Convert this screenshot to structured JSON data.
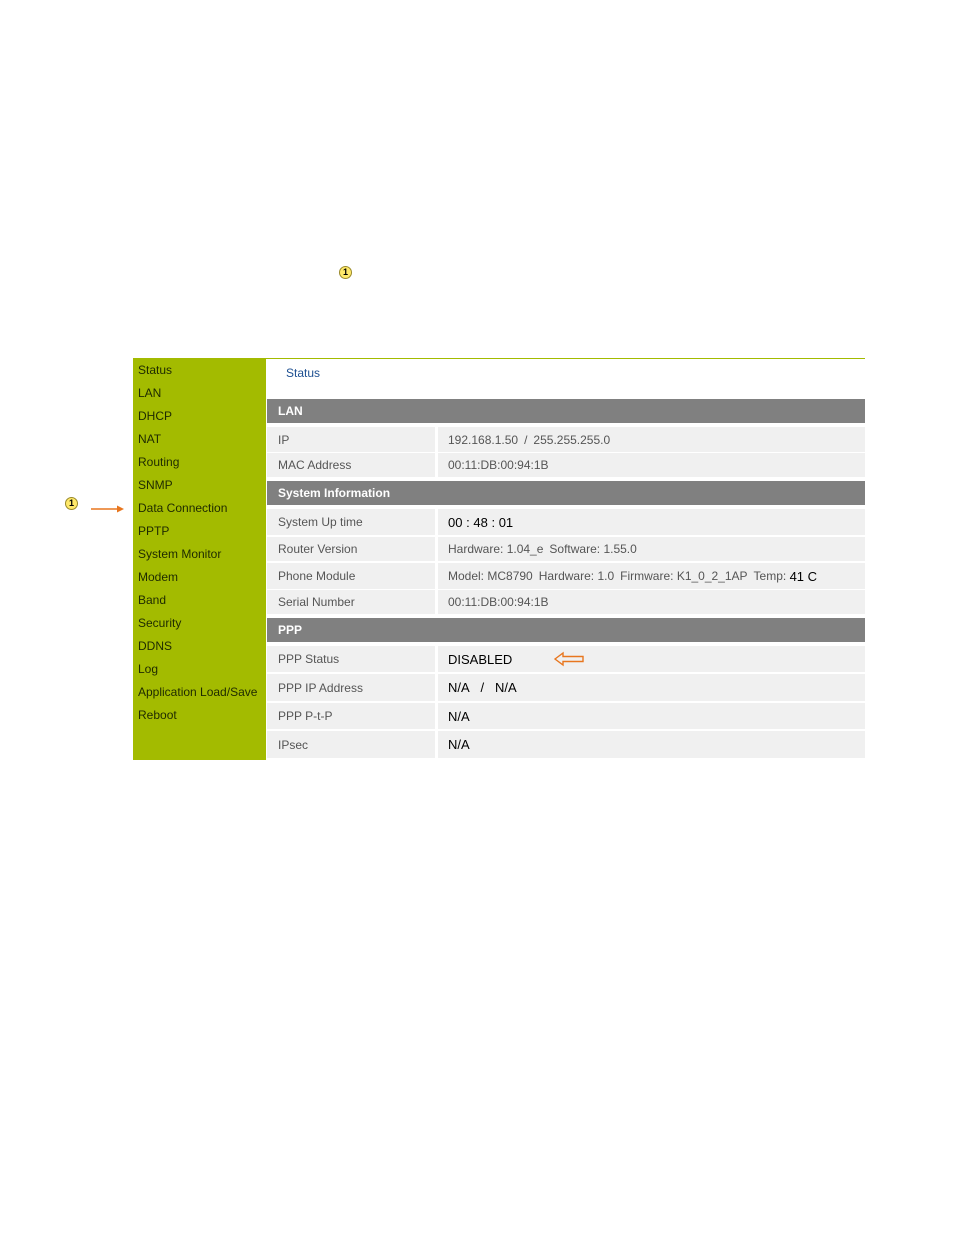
{
  "callouts": {
    "top": "1",
    "side": "1"
  },
  "sidebar": {
    "items": [
      {
        "label": "Status"
      },
      {
        "label": "LAN"
      },
      {
        "label": "DHCP"
      },
      {
        "label": "NAT"
      },
      {
        "label": "Routing"
      },
      {
        "label": "SNMP"
      },
      {
        "label": "Data Connection"
      },
      {
        "label": "PPTP"
      },
      {
        "label": "System Monitor"
      },
      {
        "label": "Modem"
      },
      {
        "label": "Band"
      },
      {
        "label": "Security"
      },
      {
        "label": "DDNS"
      },
      {
        "label": "Log"
      },
      {
        "label": "Application Load/Save"
      },
      {
        "label": "Reboot"
      }
    ]
  },
  "page": {
    "title": "Status"
  },
  "lan": {
    "header": "LAN",
    "ip": {
      "label": "IP",
      "address": "192.168.1.50",
      "sep": "/",
      "mask": "255.255.255.0"
    },
    "mac": {
      "label": "MAC Address",
      "value": "00:11:DB:00:94:1B"
    }
  },
  "system": {
    "header": "System Information",
    "uptime": {
      "label": "System Up time",
      "h": "00",
      "m": "48",
      "s": "01",
      "sep": ":"
    },
    "router": {
      "label": "Router Version",
      "hw_label": "Hardware:",
      "hw": "1.04_e",
      "sw_label": "Software:",
      "sw": "1.55.0"
    },
    "phone": {
      "label": "Phone Module",
      "model_label": "Model:",
      "model": "MC8790",
      "hw_label": "Hardware:",
      "hw": "1.0",
      "fw_label": "Firmware:",
      "fw": "K1_0_2_1AP",
      "temp_label": "Temp:",
      "temp": "41 C"
    },
    "serial": {
      "label": "Serial Number",
      "value": "00:11:DB:00:94:1B"
    }
  },
  "ppp": {
    "header": "PPP",
    "status": {
      "label": "PPP Status",
      "value": "DISABLED"
    },
    "ip": {
      "label": "PPP IP Address",
      "local": "N/A",
      "sep": "/",
      "remote": "N/A"
    },
    "ptp": {
      "label": "PPP P-t-P",
      "value": "N/A"
    },
    "ipsec": {
      "label": "IPsec",
      "value": "N/A"
    }
  },
  "colors": {
    "sidebar_bg": "#a3bb00",
    "header_bg": "#808080",
    "row_bg": "#f0f0f0",
    "link": "#1d4f91",
    "annotation_arrow": "#e8761e",
    "callout_fill": "#ffe96a"
  }
}
